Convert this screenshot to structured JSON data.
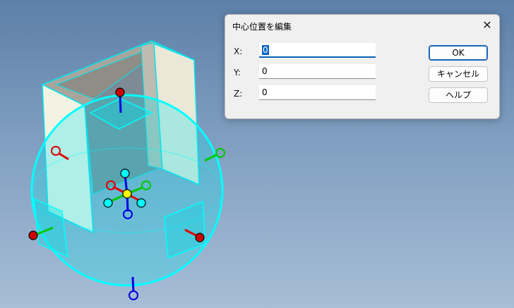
{
  "dialog": {
    "title": "中心位置を編集",
    "close_glyph": "✕",
    "fields": [
      {
        "label": "X:",
        "value": "0"
      },
      {
        "label": "Y:",
        "value": "0"
      },
      {
        "label": "Z:",
        "value": "0"
      }
    ],
    "buttons": {
      "ok": "OK",
      "cancel": "キャンセル",
      "help": "ヘルプ"
    }
  },
  "colors": {
    "gizmo": "#00ffff",
    "x_axis": "#e00000",
    "y_axis": "#00c800",
    "z_axis": "#0000e0",
    "center": "#ffff00"
  }
}
